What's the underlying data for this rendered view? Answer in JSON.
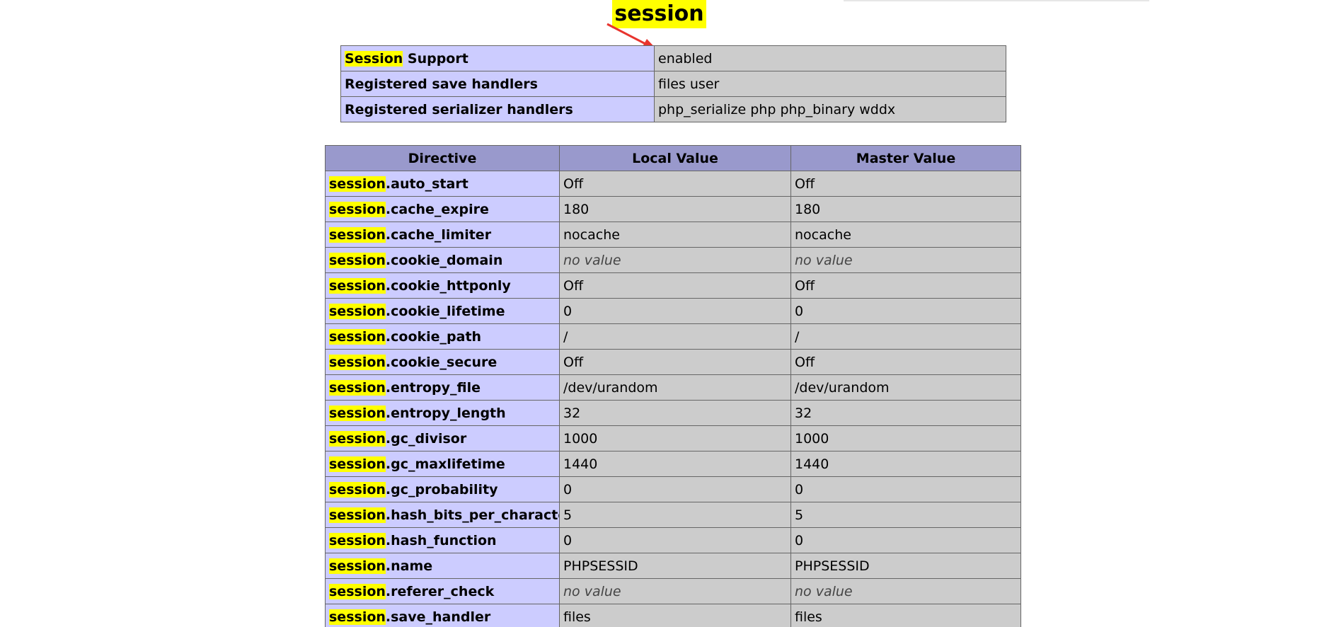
{
  "title": "session",
  "support": [
    {
      "label_highlight": "Session",
      "label_rest": " Support",
      "value": "enabled"
    },
    {
      "label_highlight": "",
      "label_rest": "Registered save handlers",
      "value": "files user"
    },
    {
      "label_highlight": "",
      "label_rest": "Registered serializer handlers",
      "value": "php_serialize php php_binary wddx"
    }
  ],
  "directive_table": {
    "headers": [
      "Directive",
      "Local Value",
      "Master Value"
    ],
    "prefix": "session",
    "rows": [
      {
        "name": ".auto_start",
        "local": "Off",
        "master": "Off"
      },
      {
        "name": ".cache_expire",
        "local": "180",
        "master": "180"
      },
      {
        "name": ".cache_limiter",
        "local": "nocache",
        "master": "nocache"
      },
      {
        "name": ".cookie_domain",
        "local": "no value",
        "master": "no value"
      },
      {
        "name": ".cookie_httponly",
        "local": "Off",
        "master": "Off"
      },
      {
        "name": ".cookie_lifetime",
        "local": "0",
        "master": "0"
      },
      {
        "name": ".cookie_path",
        "local": "/",
        "master": "/"
      },
      {
        "name": ".cookie_secure",
        "local": "Off",
        "master": "Off"
      },
      {
        "name": ".entropy_file",
        "local": "/dev/urandom",
        "master": "/dev/urandom"
      },
      {
        "name": ".entropy_length",
        "local": "32",
        "master": "32"
      },
      {
        "name": ".gc_divisor",
        "local": "1000",
        "master": "1000"
      },
      {
        "name": ".gc_maxlifetime",
        "local": "1440",
        "master": "1440"
      },
      {
        "name": ".gc_probability",
        "local": "0",
        "master": "0"
      },
      {
        "name": ".hash_bits_per_character",
        "local": "5",
        "master": "5"
      },
      {
        "name": ".hash_function",
        "local": "0",
        "master": "0"
      },
      {
        "name": ".name",
        "local": "PHPSESSID",
        "master": "PHPSESSID"
      },
      {
        "name": ".referer_check",
        "local": "no value",
        "master": "no value"
      },
      {
        "name": ".save_handler",
        "local": "files",
        "master": "files"
      }
    ]
  },
  "colors": {
    "highlight": "#ffff00",
    "label_cell": "#ccccff",
    "value_cell": "#cccccc",
    "header_cell": "#9999cc",
    "arrow": "#e8342e"
  }
}
